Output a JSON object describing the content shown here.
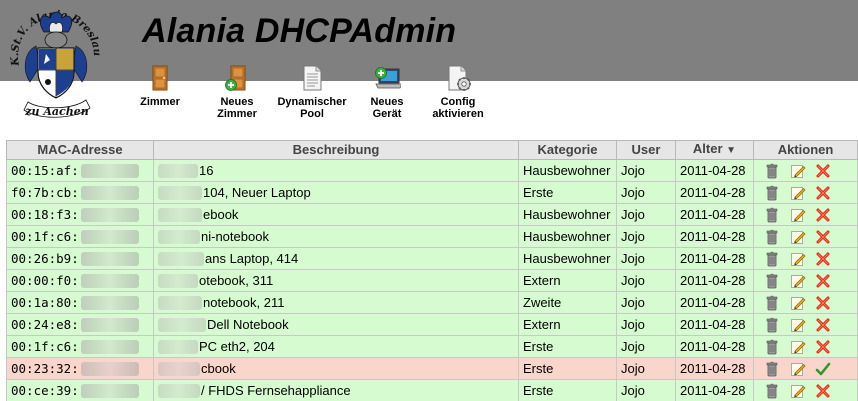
{
  "app": {
    "title": "Alania DHCPAdmin"
  },
  "logo": {
    "text_top": "K.St.V. Alania Breslau",
    "text_bottom": "zu Aachen",
    "icon": "crest-logo"
  },
  "toolbar": [
    {
      "label": "Zimmer",
      "icon": "door-icon"
    },
    {
      "label": "Neues\nZimmer",
      "icon": "door-add-icon"
    },
    {
      "label": "Dynamischer\nPool",
      "icon": "document-icon"
    },
    {
      "label": "Neues\nGerät",
      "icon": "laptop-add-icon"
    },
    {
      "label": "Config\naktivieren",
      "icon": "config-gear-icon"
    }
  ],
  "table": {
    "headers": {
      "mac": "MAC-Adresse",
      "desc": "Beschreibung",
      "cat": "Kategorie",
      "user": "User",
      "age": "Alter",
      "age_sort": "▼",
      "actions": "Aktionen"
    },
    "rows": [
      {
        "mac": "00:15:af:",
        "desc": "16",
        "cat": "Hausbewohner",
        "user": "Jojo",
        "age": "2011-04-28",
        "status": "ok"
      },
      {
        "mac": "f0:7b:cb:",
        "desc": "104, Neuer Laptop",
        "cat": "Erste",
        "user": "Jojo",
        "age": "2011-04-28",
        "status": "ok"
      },
      {
        "mac": "00:18:f3:",
        "desc": "ebook",
        "cat": "Hausbewohner",
        "user": "Jojo",
        "age": "2011-04-28",
        "status": "ok"
      },
      {
        "mac": "00:1f:c6:",
        "desc": "ni-notebook",
        "cat": "Hausbewohner",
        "user": "Jojo",
        "age": "2011-04-28",
        "status": "ok"
      },
      {
        "mac": "00:26:b9:",
        "desc": "ans Laptop, 414",
        "cat": "Hausbewohner",
        "user": "Jojo",
        "age": "2011-04-28",
        "status": "ok"
      },
      {
        "mac": "00:00:f0:",
        "desc": "otebook, 311",
        "cat": "Extern",
        "user": "Jojo",
        "age": "2011-04-28",
        "status": "ok"
      },
      {
        "mac": "00:1a:80:",
        "desc": "notebook, 211",
        "cat": "Zweite",
        "user": "Jojo",
        "age": "2011-04-28",
        "status": "ok"
      },
      {
        "mac": "00:24:e8:",
        "desc": "Dell Notebook",
        "cat": "Extern",
        "user": "Jojo",
        "age": "2011-04-28",
        "status": "ok"
      },
      {
        "mac": "00:1f:c6:",
        "desc": "PC eth2, 204",
        "cat": "Erste",
        "user": "Jojo",
        "age": "2011-04-28",
        "status": "ok"
      },
      {
        "mac": "00:23:32:",
        "desc": "cbook",
        "cat": "Erste",
        "user": "Jojo",
        "age": "2011-04-28",
        "status": "bad"
      },
      {
        "mac": "00:ce:39:",
        "desc": "/ FHDS Fernsehappliance",
        "cat": "Erste",
        "user": "Jojo",
        "age": "2011-04-28",
        "status": "ok"
      }
    ]
  },
  "colors": {
    "header_band": "#808080",
    "row_ok": "#d7fbd0",
    "row_bad": "#f9d5cc",
    "delete_red": "#e02010",
    "activate_green": "#2a9a2a"
  }
}
